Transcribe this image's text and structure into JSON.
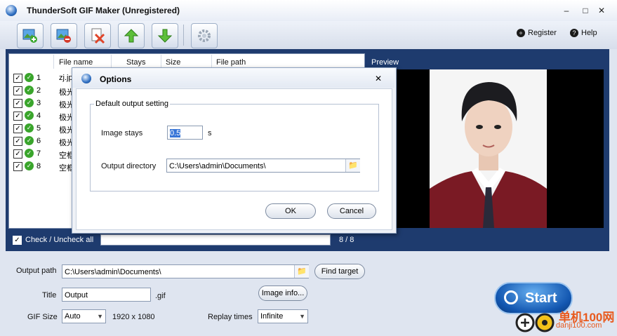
{
  "window": {
    "title": "ThunderSoft GIF Maker (Unregistered)",
    "controls": [
      "–",
      "□",
      "✕"
    ]
  },
  "toolbar": {
    "buttons": [
      "add-image-icon",
      "remove-image-icon",
      "clear-list-icon",
      "move-up-icon",
      "move-down-icon",
      "settings-gear-icon"
    ],
    "register_label": "Register",
    "help_label": "Help"
  },
  "file_list": {
    "columns": [
      "File name",
      "Stays",
      "Size",
      "File path"
    ],
    "rows": [
      {
        "num": "1",
        "name": "zj.jpg"
      },
      {
        "num": "2",
        "name": "极光"
      },
      {
        "num": "3",
        "name": "极光"
      },
      {
        "num": "4",
        "name": "极光"
      },
      {
        "num": "5",
        "name": "极光"
      },
      {
        "num": "6",
        "name": "极光"
      },
      {
        "num": "7",
        "name": "空框"
      },
      {
        "num": "8",
        "name": "空框"
      }
    ]
  },
  "preview": {
    "title": "Preview"
  },
  "check_all": {
    "label": "Check / Uncheck all",
    "count": "8 / 8"
  },
  "settings": {
    "output_path_label": "Output path",
    "output_path_value": "C:\\Users\\admin\\Documents\\",
    "find_target_label": "Find target",
    "title_label": "Title",
    "title_value": "Output",
    "title_ext": ".gif",
    "image_info_label": "Image info...",
    "gif_size_label": "GIF Size",
    "gif_size_value": "Auto",
    "gif_dimensions": "1920 x 1080",
    "replay_label": "Replay times",
    "replay_value": "Infinite",
    "start_label": "Start"
  },
  "dialog": {
    "title": "Options",
    "group_label": "Default output setting",
    "image_stays_label": "Image stays",
    "image_stays_value": "0.5",
    "image_stays_unit": "s",
    "output_dir_label": "Output directory",
    "output_dir_value": "C:\\Users\\admin\\Documents\\",
    "ok_label": "OK",
    "cancel_label": "Cancel"
  },
  "watermark": {
    "text": "单机100网",
    "url_text": "danji100.com"
  },
  "colors": {
    "panel": "#1e3b6e",
    "accent": "#1256b0",
    "watermark": "#e85a1e"
  }
}
